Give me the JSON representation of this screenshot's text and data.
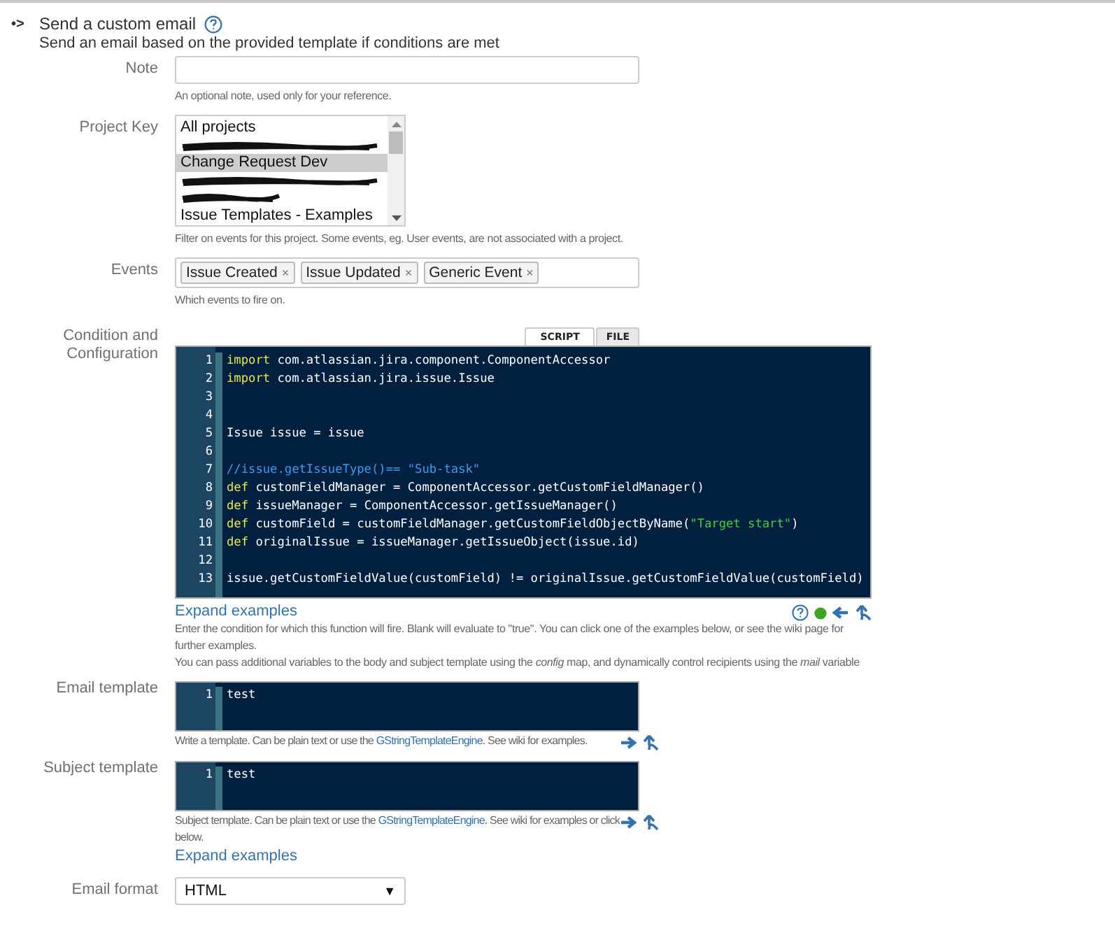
{
  "header": {
    "bullet": "•>",
    "title": "Send a custom email",
    "description": "Send an email based on the provided template if conditions are met"
  },
  "fields": [
    {
      "kind": "text",
      "label": "Note",
      "hint": "An optional note, used only for your reference."
    },
    {
      "kind": "listbox",
      "label": "Project Key",
      "hint": "Filter on events for this project. Some events, eg. User events, are not associated with a project.",
      "options": [
        {
          "kind": "option",
          "text": "All projects",
          "selected": false
        },
        {
          "kind": "redacted",
          "selected": false
        },
        {
          "kind": "option",
          "text": "Change Request Dev",
          "selected": true
        },
        {
          "kind": "redacted",
          "selected": false
        },
        {
          "kind": "redacted",
          "selected": false
        },
        {
          "kind": "option",
          "text": "Issue Templates - Examples",
          "selected": false
        }
      ]
    },
    {
      "kind": "tags",
      "label": "Events",
      "hint": "Which events to fire on.",
      "tags": [
        "Issue Created",
        "Issue Updated",
        "Generic Event"
      ],
      "remove": "×"
    },
    {
      "kind": "code",
      "label": "Condition and Configuration",
      "tabs": [
        {
          "label": "SCRIPT",
          "selected": true
        },
        {
          "label": "FILE",
          "selected": false
        }
      ],
      "lines": [
        {
          "number": "1",
          "segments": [
            {
              "kind": "keyword",
              "text": "import"
            },
            {
              "kind": "plain",
              "text": " com.atlassian.jira.component.ComponentAccessor"
            }
          ]
        },
        {
          "number": "2",
          "segments": [
            {
              "kind": "keyword",
              "text": "import"
            },
            {
              "kind": "plain",
              "text": " com.atlassian.jira.issue.Issue"
            }
          ]
        },
        {
          "number": "3"
        },
        {
          "number": "4"
        },
        {
          "number": "5",
          "segments": [
            {
              "kind": "plain",
              "text": "Issue issue = issue"
            }
          ]
        },
        {
          "number": "6"
        },
        {
          "number": "7",
          "segments": [
            {
              "kind": "comment",
              "text": "//issue.getIssueType()== \"Sub-task\""
            }
          ]
        },
        {
          "number": "8",
          "segments": [
            {
              "kind": "keyword",
              "text": "def"
            },
            {
              "kind": "plain",
              "text": " customFieldManager = ComponentAccessor.getCustomFieldManager()"
            }
          ]
        },
        {
          "number": "9",
          "segments": [
            {
              "kind": "keyword",
              "text": "def"
            },
            {
              "kind": "plain",
              "text": " issueManager = ComponentAccessor.getIssueManager()"
            }
          ]
        },
        {
          "number": "10",
          "segments": [
            {
              "kind": "keyword",
              "text": "def"
            },
            {
              "kind": "plain",
              "text": " customField = customFieldManager.getCustomFieldObjectByName("
            },
            {
              "kind": "string",
              "text": "\"Target start\""
            },
            {
              "kind": "plain",
              "text": ")"
            }
          ]
        },
        {
          "number": "11",
          "segments": [
            {
              "kind": "keyword",
              "text": "def"
            },
            {
              "kind": "plain",
              "text": " originalIssue = issueManager.getIssueObject(issue.id)"
            }
          ]
        },
        {
          "number": "12"
        },
        {
          "number": "13",
          "segments": [
            {
              "kind": "plain",
              "text": "issue.getCustomFieldValue(customField) != originalIssue.getCustomFieldValue(customField)"
            }
          ]
        }
      ],
      "link": "Expand examples",
      "status_ok": true,
      "hints": [
        "Enter the condition for which this function will fire. Blank will evaluate to \"true\". You can click one of the examples below, or see the wiki page for further examples.",
        "You can pass additional variables to the body and subject template using the *config* map, and dynamically control recipients using the *mail* variable"
      ]
    },
    {
      "kind": "template",
      "label": "Email template",
      "lines": [
        {
          "number": "1",
          "text": "test"
        }
      ],
      "hint": [
        "Write a template. Can be plain text or use the ",
        "GStringTemplateEngine",
        ". See wiki for examples."
      ]
    },
    {
      "kind": "template",
      "label": "Subject template",
      "lines": [
        {
          "number": "1",
          "text": "test"
        }
      ],
      "hint": [
        "Subject template. Can be plain text or use the ",
        "GStringTemplateEngine",
        ". See wiki for examples or click below."
      ],
      "link": "Expand examples"
    },
    {
      "kind": "select",
      "label": "Email format",
      "value": "HTML",
      "caret": "▼"
    }
  ]
}
